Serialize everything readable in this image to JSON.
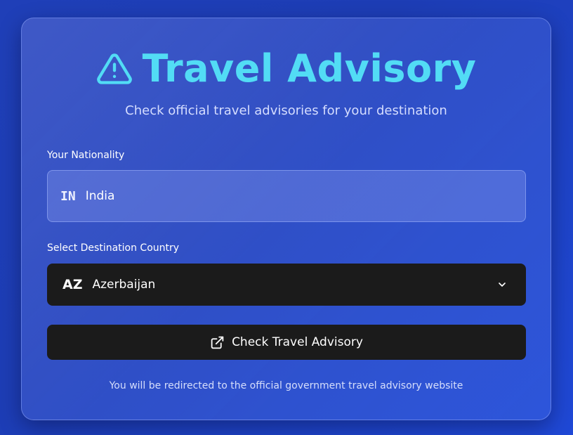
{
  "header": {
    "title": "Travel Advisory",
    "subtitle": "Check official travel advisories for your destination",
    "icon": "warning-triangle-icon"
  },
  "nationality": {
    "label": "Your Nationality",
    "code": "IN",
    "value": "India"
  },
  "destination": {
    "label": "Select Destination Country",
    "code": "AZ",
    "value": "Azerbaijan",
    "icon": "chevron-down-icon"
  },
  "action": {
    "label": "Check Travel Advisory",
    "icon": "external-link-icon"
  },
  "note": "You will be redirected to the official government travel advisory website",
  "colors": {
    "accent": "#52dcf5",
    "background": "#1f3fb8",
    "dark_control": "#1b1b1b"
  }
}
